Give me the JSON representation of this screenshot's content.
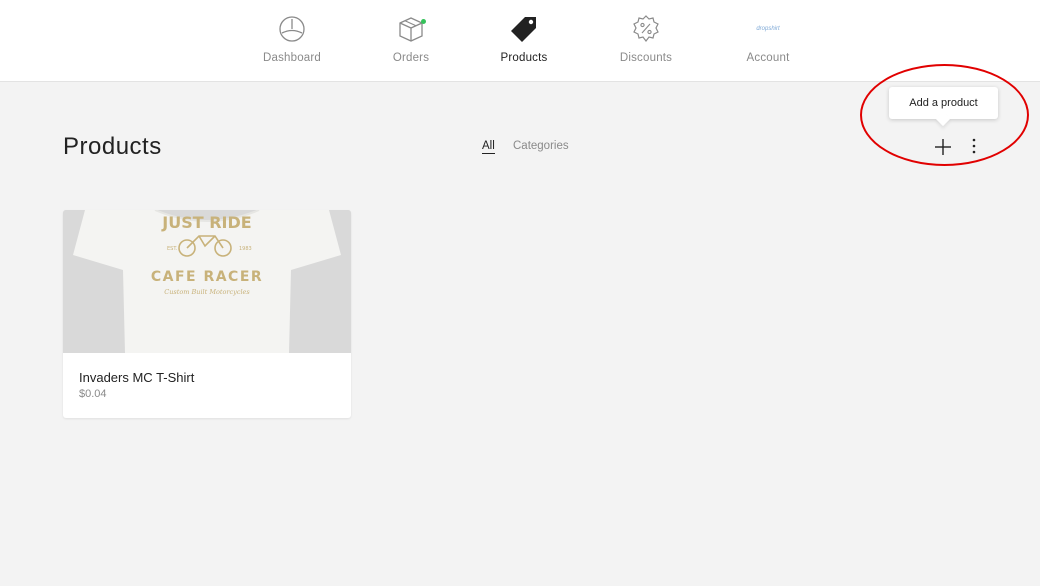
{
  "nav": {
    "items": [
      {
        "label": "Dashboard",
        "icon": "dashboard-gauge-icon"
      },
      {
        "label": "Orders",
        "icon": "orders-box-icon",
        "badge": "new-activity-dot"
      },
      {
        "label": "Products",
        "icon": "price-tag-icon"
      },
      {
        "label": "Discounts",
        "icon": "discount-badge-icon"
      },
      {
        "label": "Account",
        "icon": "store-logo-icon",
        "logo_text": "dropshirt"
      }
    ],
    "active": "Products"
  },
  "page": {
    "title": "Products",
    "filters": [
      "All",
      "Categories"
    ],
    "active_filter": "All"
  },
  "toolbar": {
    "add_tooltip": "Add a product",
    "add_icon": "plus-icon",
    "more_icon": "vertical-ellipsis-icon"
  },
  "products": [
    {
      "name": "Invaders MC T-Shirt",
      "price": "$0.04",
      "image": {
        "description_icon": "tshirt-image",
        "print_lines": [
          "JUST RIDE",
          "EST.",
          "1983",
          "CAFE RACER",
          "Custom Built Motorcycles"
        ]
      }
    }
  ],
  "colors": {
    "accent_dark": "#222222",
    "muted_text": "#8a8a8a",
    "background": "#f3f3f3",
    "highlight_ring": "#e10000",
    "status_dot": "#35c25a",
    "shirt_print": "#c8b27a"
  }
}
